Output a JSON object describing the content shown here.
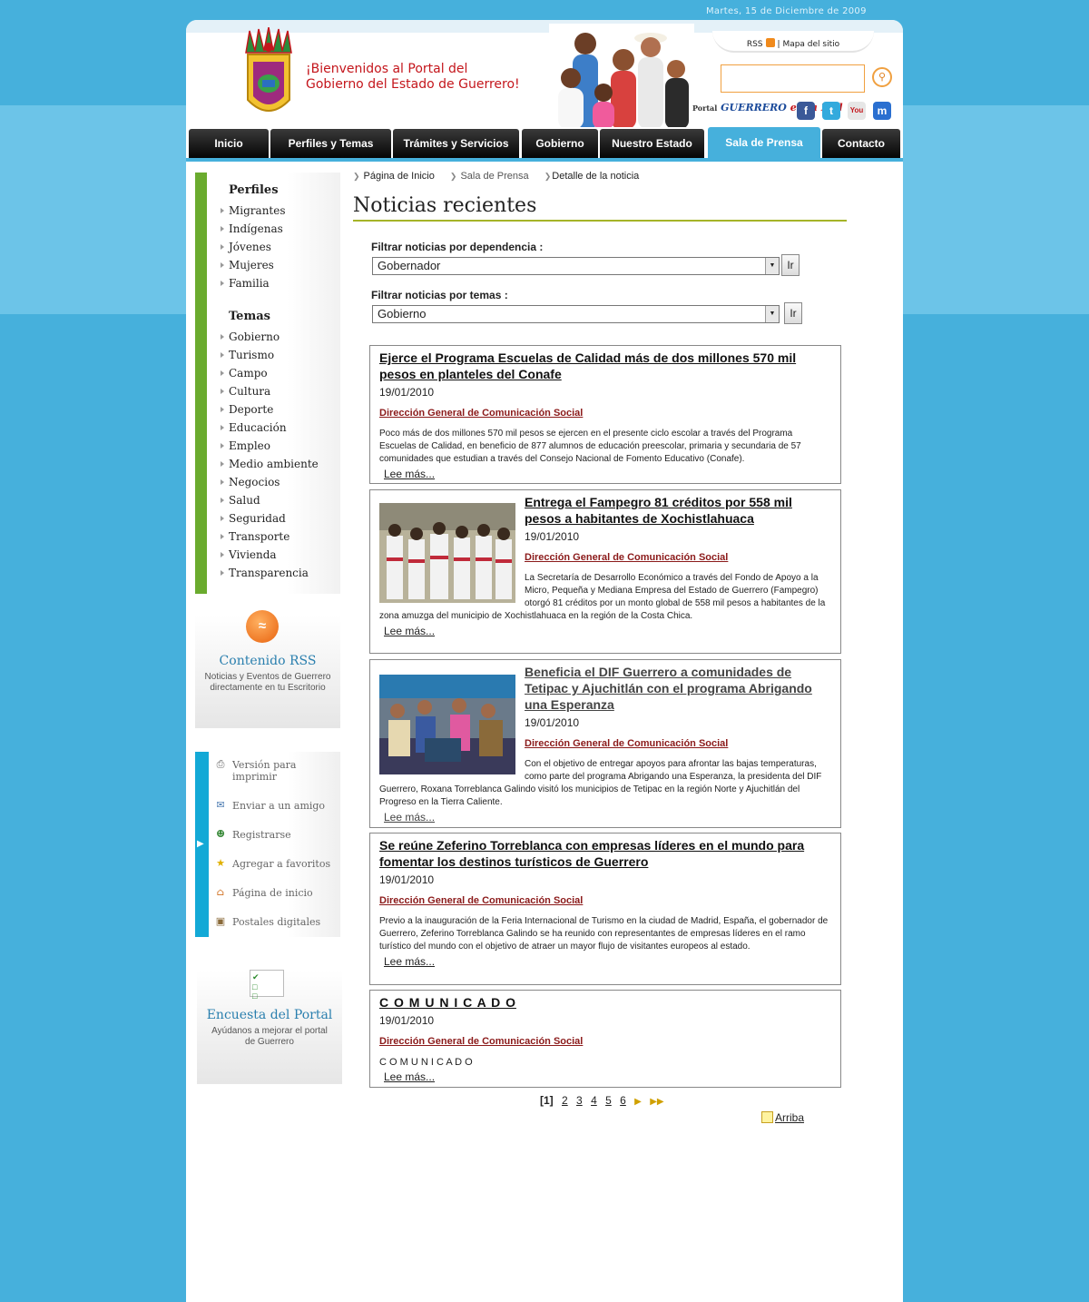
{
  "header": {
    "date": "Martes, 15 de Diciembre de 2009",
    "welcome_line1": "¡Bienvenidos al Portal del",
    "welcome_line2": "Gobierno del Estado de Guerrero!",
    "rss_label": "RSS",
    "separator": "|",
    "sitemap_label": "Mapa del sitio",
    "search": {
      "value": "",
      "placeholder": ""
    },
    "social_prefix": "Portal",
    "social_brand": "GUERRERO",
    "social_suffix": "en la Red"
  },
  "nav": {
    "tabs": [
      {
        "label": "Inicio"
      },
      {
        "label": "Perfiles y Temas"
      },
      {
        "label": "Trámites y Servicios"
      },
      {
        "label": "Gobierno"
      },
      {
        "label": "Nuestro Estado"
      },
      {
        "label": "Sala de Prensa",
        "active": true
      },
      {
        "label": "Contacto"
      }
    ]
  },
  "sidebar": {
    "perfiles_title": "Perfiles",
    "perfiles": [
      "Migrantes",
      "Indígenas",
      "Jóvenes",
      "Mujeres",
      "Familia"
    ],
    "temas_title": "Temas",
    "temas": [
      "Gobierno",
      "Turismo",
      "Campo",
      "Cultura",
      "Deporte",
      "Educación",
      "Empleo",
      "Medio ambiente",
      "Negocios",
      "Salud",
      "Seguridad",
      "Transporte",
      "Vivienda",
      "Transparencia"
    ],
    "rss_box": {
      "title": "Contenido RSS",
      "text": "Noticias y Eventos de Guerrero directamente en tu Escritorio"
    },
    "tools": [
      {
        "label": "Versión para imprimir",
        "icon": "printer-icon"
      },
      {
        "label": "Enviar a un amigo",
        "icon": "envelope-icon"
      },
      {
        "label": "Registrarse",
        "icon": "user-icon"
      },
      {
        "label": "Agregar a favoritos",
        "icon": "star-icon"
      },
      {
        "label": "Página de inicio",
        "icon": "home-icon"
      },
      {
        "label": "Postales digitales",
        "icon": "postcard-icon"
      }
    ],
    "poll_box": {
      "title": "Encuesta del Portal",
      "text": "Ayúdanos a mejorar el portal de Guerrero"
    }
  },
  "breadcrumb": {
    "home": "Página de Inicio",
    "section": "Sala de Prensa",
    "current": "Detalle de la noticia"
  },
  "main": {
    "title": "Noticias recientes",
    "filter_dep_label": "Filtrar noticias por dependencia :",
    "filter_dep_value": "Gobernador",
    "filter_tema_label": "Filtrar noticias por temas :",
    "filter_tema_value": "Gobierno",
    "go_label": "Ir",
    "read_more": "Lee más...",
    "news": [
      {
        "title": "Ejerce el Programa Escuelas de Calidad más de dos millones 570 mil pesos en planteles del Conafe",
        "date": "19/01/2010",
        "dep": "Dirección General de Comunicación Social",
        "text": "Poco más de dos millones 570 mil pesos se ejercen en el presente ciclo escolar a través del Programa Escuelas de Calidad, en beneficio de 877 alumnos de educación preescolar, primaria y secundaria de 57 comunidades que estudian a través del Consejo Nacional de Fomento Educativo (Conafe)."
      },
      {
        "title": "Entrega el Fampegro 81 créditos por 558 mil pesos a habitantes de Xochistlahuaca",
        "date": "19/01/2010",
        "dep": "Dirección General de Comunicación Social",
        "text": "La Secretaría de Desarrollo Económico a través del Fondo de Apoyo a la Micro, Pequeña y Mediana Empresa del Estado de Guerrero (Fampegro) otorgó 81 créditos por un monto global de 558 mil pesos a habitantes de la zona amuzga del municipio de Xochistlahuaca en la región de la Costa Chica."
      },
      {
        "title": "Beneficia el DIF Guerrero a comunidades de Tetipac y Ajuchitlán con el programa Abrigando una Esperanza",
        "date": "19/01/2010",
        "dep": "Dirección General de Comunicación Social",
        "text": "Con el objetivo de entregar apoyos para afrontar las bajas temperaturas, como parte del programa Abrigando una Esperanza, la presidenta del DIF Guerrero, Roxana Torreblanca Galindo visitó los municipios de Tetipac en la región Norte y Ajuchitlán del Progreso en la Tierra Caliente."
      },
      {
        "title": "Se reúne Zeferino Torreblanca con empresas líderes en el mundo para fomentar los destinos turísticos de Guerrero",
        "date": "19/01/2010",
        "dep": "Dirección General de Comunicación Social",
        "text": "Previo a la inauguración de la Feria Internacional de Turismo en la ciudad de Madrid, España, el gobernador de Guerrero, Zeferino Torreblanca Galindo se ha reunido con representantes de empresas líderes en el ramo turístico del mundo con el objetivo de atraer un mayor flujo de visitantes europeos al estado."
      },
      {
        "title": "C O M U N I C A D O",
        "date": "19/01/2010",
        "dep": "Dirección General de Comunicación Social",
        "text": "C O M U N I C A D O"
      }
    ],
    "pager": {
      "current": "[1]",
      "pages": [
        "2",
        "3",
        "4",
        "5",
        "6"
      ],
      "next": "▶",
      "last": "▶▶"
    },
    "top_link": "Arriba"
  },
  "colors": {
    "page_bg": "#46b0dc",
    "nav_active": "#46b0dc",
    "sidebar_accent": "#6aab2e",
    "tools_accent": "#13a9d6",
    "dep_link": "#8b1a1a",
    "title_rule": "#a6b428"
  }
}
